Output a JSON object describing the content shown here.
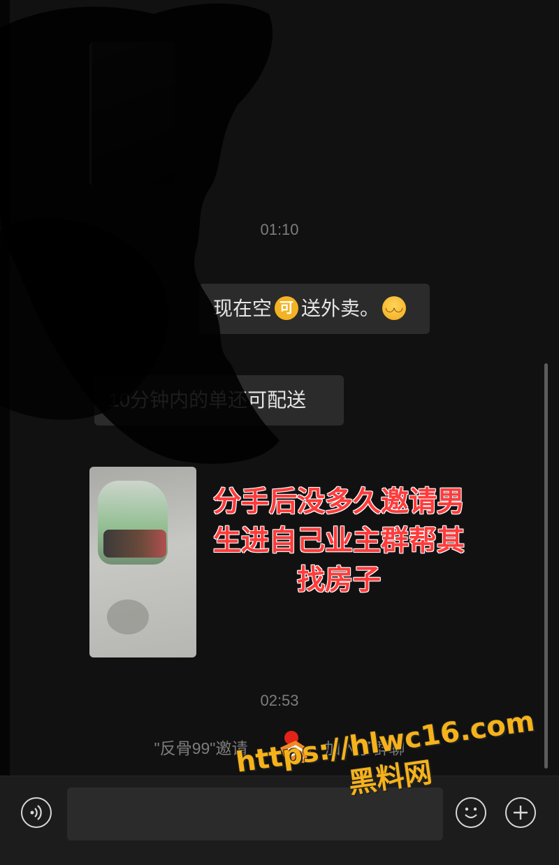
{
  "chat": {
    "timestamp_1": "01:10",
    "message_1_text_a": "现在空",
    "message_1_emoji": "可",
    "message_1_text_b": "送外卖。",
    "message_2_text": "10分钟内的单还可配送",
    "overlay_caption": "分手后没多久邀请男生进自己业主群帮其找房子",
    "timestamp_2": "02:53",
    "system_msg_part_a": "\"反骨99\"邀请",
    "system_msg_part_b": "加入了群聊"
  },
  "input_bar": {
    "text_value": ""
  },
  "icons": {
    "voice": "voice-icon",
    "emoji": "emoji-icon",
    "plus": "plus-icon",
    "smile": "smiling-face-icon"
  },
  "watermark": {
    "url": "https://hlwc16.com",
    "name": "黑料网"
  },
  "colors": {
    "background": "#111111",
    "bubble": "#2b2b2b",
    "caption_red": "#ff3b3b",
    "watermark_gold": "#f5b21a"
  }
}
